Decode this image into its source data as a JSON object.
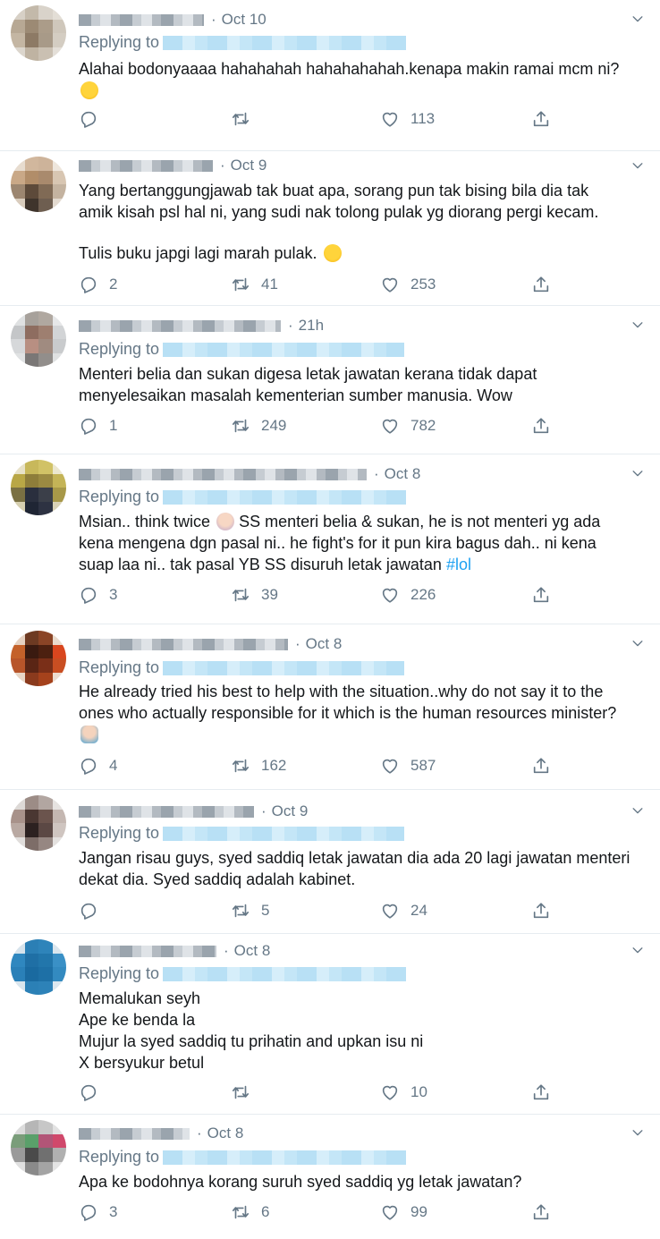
{
  "reply_prefix": "Replying to",
  "tweets": [
    {
      "date": "Oct 10",
      "lines": [
        "Alahai bodonyaaaa hahahahah hahahahahah.kenapa makin ramai mcm ni?"
      ],
      "replies": "",
      "retweets": "",
      "likes": "113"
    },
    {
      "date": "Oct 9",
      "lines": [
        "Yang bertanggungjawab tak buat apa, sorang pun tak bising bila dia tak",
        "amik kisah psl hal ni, yang sudi nak tolong pulak yg diorang pergi kecam."
      ],
      "line2": "Tulis buku japgi lagi marah pulak.",
      "replies": "2",
      "retweets": "41",
      "likes": "253"
    },
    {
      "date": "21h",
      "lines": [
        "Menteri belia dan sukan digesa letak jawatan kerana tidak dapat",
        "menyelesaikan masalah kementerian sumber manusia. Wow"
      ],
      "replies": "1",
      "retweets": "249",
      "likes": "782"
    },
    {
      "date": "Oct 8",
      "line_a": "Msian.. think twice",
      "line_b": "SS menteri belia & sukan, he is not menteri yg ada",
      "lines": [
        "kena mengena dgn pasal ni.. he fight's for it pun kira bagus dah.. ni kena"
      ],
      "line_c": "suap laa ni.. tak pasal YB SS disuruh letak jawatan",
      "hashtag": "#lol",
      "replies": "3",
      "retweets": "39",
      "likes": "226"
    },
    {
      "date": "Oct 8",
      "lines": [
        "He already tried his best to help with the situation..why do not say it to the",
        "ones who actually responsible for it which is the human resources minister?"
      ],
      "replies": "4",
      "retweets": "162",
      "likes": "587"
    },
    {
      "date": "Oct 9",
      "lines": [
        "Jangan risau guys, syed saddiq letak jawatan dia ada 20 lagi jawatan menteri",
        "dekat dia. Syed saddiq adalah kabinet."
      ],
      "replies": "",
      "retweets": "5",
      "likes": "24"
    },
    {
      "date": "Oct 8",
      "lines": [
        "Memalukan seyh",
        "Ape ke benda la",
        "Mujur la syed saddiq tu prihatin and upkan isu ni",
        "X bersyukur betul"
      ],
      "replies": "",
      "retweets": "",
      "likes": "10"
    },
    {
      "date": "Oct 8",
      "lines": [
        "Apa ke bodohnya korang suruh syed saddiq yg letak jawatan?"
      ],
      "replies": "3",
      "retweets": "6",
      "likes": "99"
    }
  ],
  "icons": [
    "reply-icon",
    "retweet-icon",
    "like-icon",
    "share-icon",
    "chevron-down-icon"
  ],
  "colors": {
    "text": "#14171a",
    "muted": "#657786",
    "link": "#1da1f2",
    "divider": "#e6ecf0"
  }
}
